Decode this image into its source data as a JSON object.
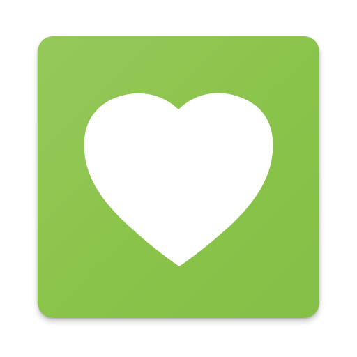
{
  "app_icon": {
    "icon": "heart-icon",
    "background_color": "#8bc34a",
    "symbol_color": "#ffffff"
  }
}
